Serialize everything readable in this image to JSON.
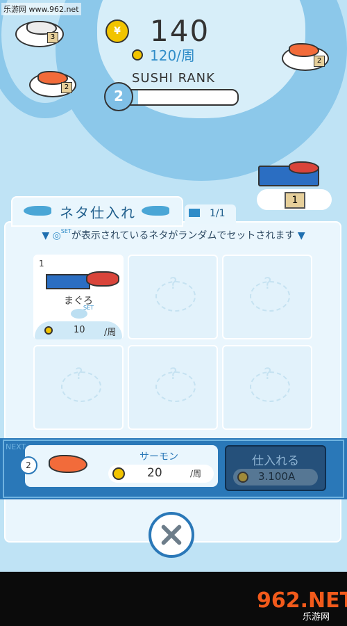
{
  "watermark": "乐游网 www.962.net",
  "header": {
    "coins": "140",
    "coin_rate": "120/周",
    "rank_label": "SUSHI RANK",
    "rank_level": "2",
    "rank_progress": 0.17
  },
  "plates": {
    "plate1_count": "3",
    "plate2_count": "2",
    "plate3_count": "2"
  },
  "boat_count": "1",
  "panel": {
    "tab_title": "ネタ仕入れ",
    "page": "1/1",
    "info_text": "が表示されているネタがランダムでセットされます",
    "set_label": "SET"
  },
  "slots": [
    {
      "number": "1",
      "name": "まぐろ",
      "rate_value": "10",
      "rate_unit": "/周"
    }
  ],
  "next": {
    "label": "NEXT",
    "number": "2",
    "name": "サーモン",
    "rate_value": "20",
    "rate_unit": "/周",
    "buy_label": "仕入れる",
    "buy_price": "3.100A"
  },
  "logo": {
    "brand": "962.NET",
    "sub": "乐游网"
  },
  "colors": {
    "accent": "#2a78b8",
    "coin": "#f2c400",
    "salmon": "#f26b3a"
  }
}
